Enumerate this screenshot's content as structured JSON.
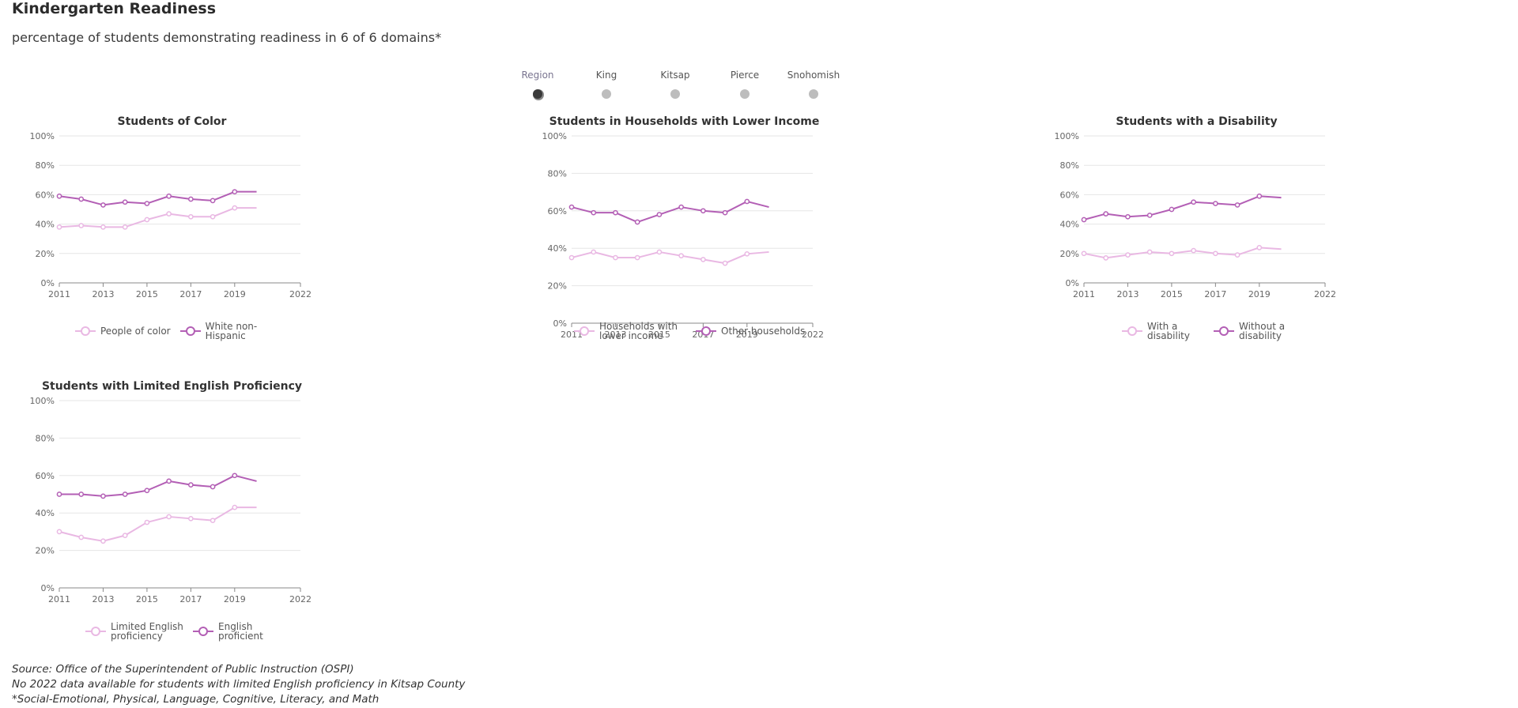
{
  "page": {
    "title": "Kindergarten Readiness",
    "subtitle": "percentage of students demonstrating readiness in 6 of 6 domains*"
  },
  "selector": {
    "options": [
      "Region",
      "King",
      "Kitsap",
      "Pierce",
      "Snohomish"
    ],
    "selected": "Region"
  },
  "colors": {
    "light_series": "#e9b8e3",
    "dark_series": "#b35fb5",
    "grid": "#e6e6e6",
    "axis": "#888888"
  },
  "chart_data": [
    {
      "type": "line",
      "title": "Students of Color",
      "x": [
        2011,
        2012,
        2013,
        2014,
        2015,
        2016,
        2017,
        2018,
        2019,
        2020
      ],
      "x_ticks": [
        "2011",
        "2013",
        "2015",
        "2017",
        "2019",
        "2022"
      ],
      "y_ticks": [
        "0%",
        "20%",
        "40%",
        "60%",
        "80%",
        "100%"
      ],
      "ylim": [
        0,
        100
      ],
      "grid": true,
      "legend": "bottom",
      "series": [
        {
          "name": "People of color",
          "values": [
            38,
            39,
            38,
            38,
            43,
            47,
            45,
            45,
            51,
            51
          ]
        },
        {
          "name": "White non-Hispanic",
          "values": [
            59,
            57,
            53,
            55,
            54,
            59,
            57,
            56,
            62,
            62
          ]
        }
      ]
    },
    {
      "type": "line",
      "title": "Students in Households with Lower Income",
      "x": [
        2011,
        2012,
        2013,
        2014,
        2015,
        2016,
        2017,
        2018,
        2019,
        2020
      ],
      "x_ticks": [
        "2011",
        "2013",
        "2015",
        "2017",
        "2019",
        "2022"
      ],
      "y_ticks": [
        "0%",
        "20%",
        "40%",
        "60%",
        "80%",
        "100%"
      ],
      "ylim": [
        0,
        100
      ],
      "grid": true,
      "legend": "bottom",
      "series": [
        {
          "name": "Households with lower income",
          "values": [
            35,
            38,
            35,
            35,
            38,
            36,
            34,
            32,
            37,
            38
          ]
        },
        {
          "name": "Other households",
          "values": [
            62,
            59,
            59,
            54,
            58,
            62,
            60,
            59,
            65,
            62
          ]
        }
      ]
    },
    {
      "type": "line",
      "title": "Students with a Disability",
      "x": [
        2011,
        2012,
        2013,
        2014,
        2015,
        2016,
        2017,
        2018,
        2019,
        2020
      ],
      "x_ticks": [
        "2011",
        "2013",
        "2015",
        "2017",
        "2019",
        "2022"
      ],
      "y_ticks": [
        "0%",
        "20%",
        "40%",
        "60%",
        "80%",
        "100%"
      ],
      "ylim": [
        0,
        100
      ],
      "grid": true,
      "legend": "bottom",
      "series": [
        {
          "name": "With a disability",
          "values": [
            20,
            17,
            19,
            21,
            20,
            22,
            20,
            19,
            24,
            23
          ]
        },
        {
          "name": "Without a disability",
          "values": [
            43,
            47,
            45,
            46,
            50,
            55,
            54,
            53,
            59,
            58
          ]
        }
      ]
    },
    {
      "type": "line",
      "title": "Students with Limited English Proficiency",
      "x": [
        2011,
        2012,
        2013,
        2014,
        2015,
        2016,
        2017,
        2018,
        2019,
        2020
      ],
      "x_ticks": [
        "2011",
        "2013",
        "2015",
        "2017",
        "2019",
        "2022"
      ],
      "y_ticks": [
        "0%",
        "20%",
        "40%",
        "60%",
        "80%",
        "100%"
      ],
      "ylim": [
        0,
        100
      ],
      "grid": true,
      "legend": "bottom",
      "series": [
        {
          "name": "Limited English proficiency",
          "values": [
            30,
            27,
            25,
            28,
            35,
            38,
            37,
            36,
            43,
            43
          ]
        },
        {
          "name": "English proficient",
          "values": [
            50,
            50,
            49,
            50,
            52,
            57,
            55,
            54,
            60,
            57
          ]
        }
      ]
    }
  ],
  "footer": {
    "source": "Source: Office of the Superintendent of Public Instruction (OSPI)",
    "note": "No 2022 data available for students with limited English proficiency in Kitsap County",
    "footnote": "*Social-Emotional, Physical, Language, Cognitive, Literacy, and Math"
  }
}
